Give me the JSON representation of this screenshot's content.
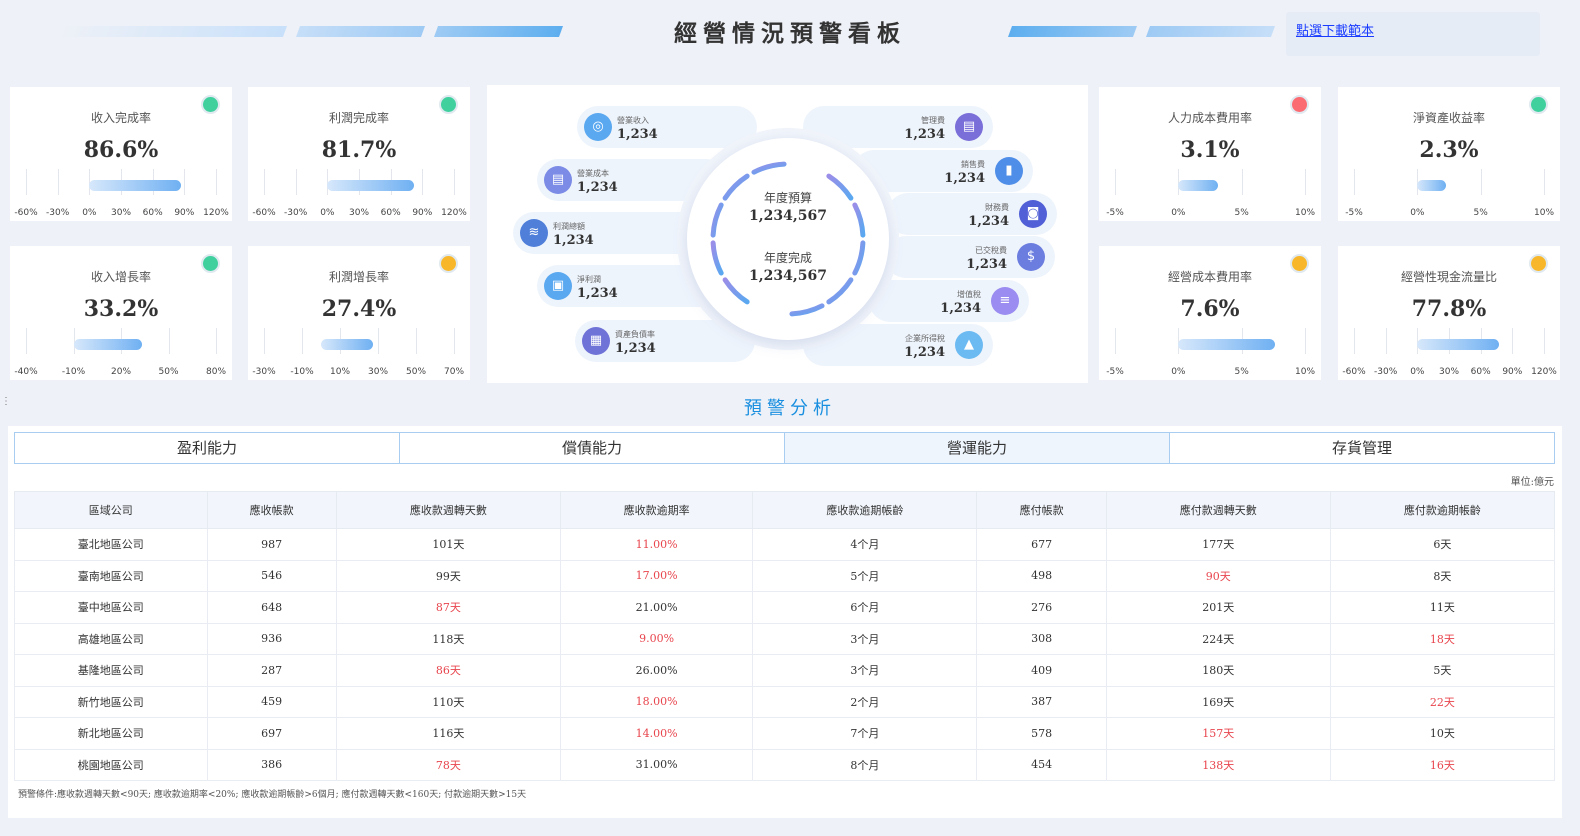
{
  "header": {
    "title": "經營情況預警看板",
    "download_link": "點選下載範本"
  },
  "colors": {
    "green": "#3fd09e",
    "red": "#fb6b72",
    "orange": "#f8b72a",
    "accent_blue": "#1a8fe0",
    "alert_red": "#e8454d"
  },
  "kpis": [
    {
      "id": "revenue-completion",
      "name": "收入完成率",
      "value": "86.6%",
      "status": "green",
      "ticks": [
        "-60%",
        "-30%",
        "0%",
        "30%",
        "60%",
        "90%",
        "120%"
      ],
      "range": [
        -60,
        120
      ],
      "bar": [
        0,
        86.6
      ]
    },
    {
      "id": "profit-completion",
      "name": "利潤完成率",
      "value": "81.7%",
      "status": "green",
      "ticks": [
        "-60%",
        "-30%",
        "0%",
        "30%",
        "60%",
        "90%",
        "120%"
      ],
      "range": [
        -60,
        120
      ],
      "bar": [
        0,
        81.7
      ]
    },
    {
      "id": "labor-cost-rate",
      "name": "人力成本費用率",
      "value": "3.1%",
      "status": "red",
      "ticks": [
        "-5%",
        "0%",
        "5%",
        "10%"
      ],
      "range": [
        -5,
        10
      ],
      "bar": [
        0,
        3.1
      ]
    },
    {
      "id": "roe",
      "name": "淨資產收益率",
      "value": "2.3%",
      "status": "green",
      "ticks": [
        "-5%",
        "0%",
        "5%",
        "10%"
      ],
      "range": [
        -5,
        10
      ],
      "bar": [
        0,
        2.3
      ]
    },
    {
      "id": "revenue-growth",
      "name": "收入增長率",
      "value": "33.2%",
      "status": "green",
      "ticks": [
        "-40%",
        "-10%",
        "20%",
        "50%",
        "80%"
      ],
      "range": [
        -40,
        80
      ],
      "bar": [
        -10,
        33.2
      ]
    },
    {
      "id": "profit-growth",
      "name": "利潤增長率",
      "value": "27.4%",
      "status": "orange",
      "ticks": [
        "-30%",
        "-10%",
        "10%",
        "30%",
        "50%",
        "70%"
      ],
      "range": [
        -30,
        70
      ],
      "bar": [
        0,
        27.4
      ]
    },
    {
      "id": "operating-cost-rate",
      "name": "經營成本費用率",
      "value": "7.6%",
      "status": "orange",
      "ticks": [
        "-5%",
        "0%",
        "5%",
        "10%"
      ],
      "range": [
        -5,
        10
      ],
      "bar": [
        0,
        7.6
      ]
    },
    {
      "id": "cashflow-ratio",
      "name": "經營性現金流量比",
      "value": "77.8%",
      "status": "orange",
      "ticks": [
        "-60%",
        "-30%",
        "0%",
        "30%",
        "60%",
        "90%",
        "120%"
      ],
      "range": [
        -60,
        120
      ],
      "bar": [
        0,
        77.8
      ]
    }
  ],
  "center": {
    "budget_label": "年度預算",
    "budget_value": "1,234,567",
    "done_label": "年度完成",
    "done_value": "1,234,567",
    "left_items": [
      {
        "label": "營業收入",
        "value": "1,234",
        "icon": "wallet-icon",
        "glyph": "◎",
        "color": "#5aa8f0"
      },
      {
        "label": "營業成本",
        "value": "1,234",
        "icon": "invoice-icon",
        "glyph": "▤",
        "color": "#7b8be6"
      },
      {
        "label": "利潤總額",
        "value": "1,234",
        "icon": "database-icon",
        "glyph": "≋",
        "color": "#4f7fd9"
      },
      {
        "label": "淨利潤",
        "value": "1,234",
        "icon": "monitor-chart-icon",
        "glyph": "▣",
        "color": "#5aa8f0"
      },
      {
        "label": "資產負債率",
        "value": "1,234",
        "icon": "ledger-icon",
        "glyph": "▦",
        "color": "#6f72d6"
      }
    ],
    "right_items": [
      {
        "label": "管理費",
        "value": "1,234",
        "icon": "calendar-icon",
        "glyph": "▤",
        "color": "#7a6fd8"
      },
      {
        "label": "銷售費",
        "value": "1,234",
        "icon": "bar-chart-icon",
        "glyph": "▮",
        "color": "#4f8ee8"
      },
      {
        "label": "財務費",
        "value": "1,234",
        "icon": "safe-icon",
        "glyph": "◙",
        "color": "#5160d6"
      },
      {
        "label": "已交稅費",
        "value": "1,234",
        "icon": "tax-coin-icon",
        "glyph": "$",
        "color": "#6b7ee0"
      },
      {
        "label": "增值稅",
        "value": "1,234",
        "icon": "coins-icon",
        "glyph": "≡",
        "color": "#9a8cf0"
      },
      {
        "label": "企業所得稅",
        "value": "1,234",
        "icon": "growth-chart-icon",
        "glyph": "▲",
        "color": "#6cbaf2"
      }
    ]
  },
  "analysis": {
    "title": "預警分析",
    "tabs": [
      "盈利能力",
      "償債能力",
      "營運能力",
      "存貨管理"
    ],
    "active_tab": 2,
    "unit": "單位:億元",
    "columns": [
      "區域公司",
      "應收帳款",
      "應收款週轉天數",
      "應收款逾期率",
      "應收款逾期帳齡",
      "應付帳款",
      "應付款週轉天數",
      "應付款逾期帳齡"
    ],
    "rows": [
      [
        "臺北地區公司",
        "987",
        "101天",
        "11.00%",
        "4个月",
        "677",
        "177天",
        "6天"
      ],
      [
        "臺南地區公司",
        "546",
        "99天",
        "17.00%",
        "5个月",
        "498",
        "90天",
        "8天"
      ],
      [
        "臺中地區公司",
        "648",
        "87天",
        "21.00%",
        "6个月",
        "276",
        "201天",
        "11天"
      ],
      [
        "高雄地區公司",
        "936",
        "118天",
        "9.00%",
        "3个月",
        "308",
        "224天",
        "18天"
      ],
      [
        "基隆地區公司",
        "287",
        "86天",
        "26.00%",
        "3个月",
        "409",
        "180天",
        "5天"
      ],
      [
        "新竹地區公司",
        "459",
        "110天",
        "18.00%",
        "2个月",
        "387",
        "169天",
        "22天"
      ],
      [
        "新北地區公司",
        "697",
        "116天",
        "14.00%",
        "7个月",
        "578",
        "157天",
        "10天"
      ],
      [
        "桃園地區公司",
        "386",
        "78天",
        "31.00%",
        "8个月",
        "454",
        "138天",
        "16天"
      ]
    ],
    "red_cells": [
      [
        0,
        3
      ],
      [
        1,
        3
      ],
      [
        1,
        6
      ],
      [
        2,
        2
      ],
      [
        3,
        3
      ],
      [
        3,
        7
      ],
      [
        4,
        2
      ],
      [
        5,
        3
      ],
      [
        5,
        7
      ],
      [
        6,
        3
      ],
      [
        6,
        6
      ],
      [
        7,
        2
      ],
      [
        7,
        6
      ],
      [
        7,
        7
      ]
    ],
    "note": "預警條件:應收款週轉天數<90天; 應收款逾期率<20%; 應收款逾期帳齡>6個月; 應付款週轉天數<160天; 付款逾期天數>15天"
  }
}
